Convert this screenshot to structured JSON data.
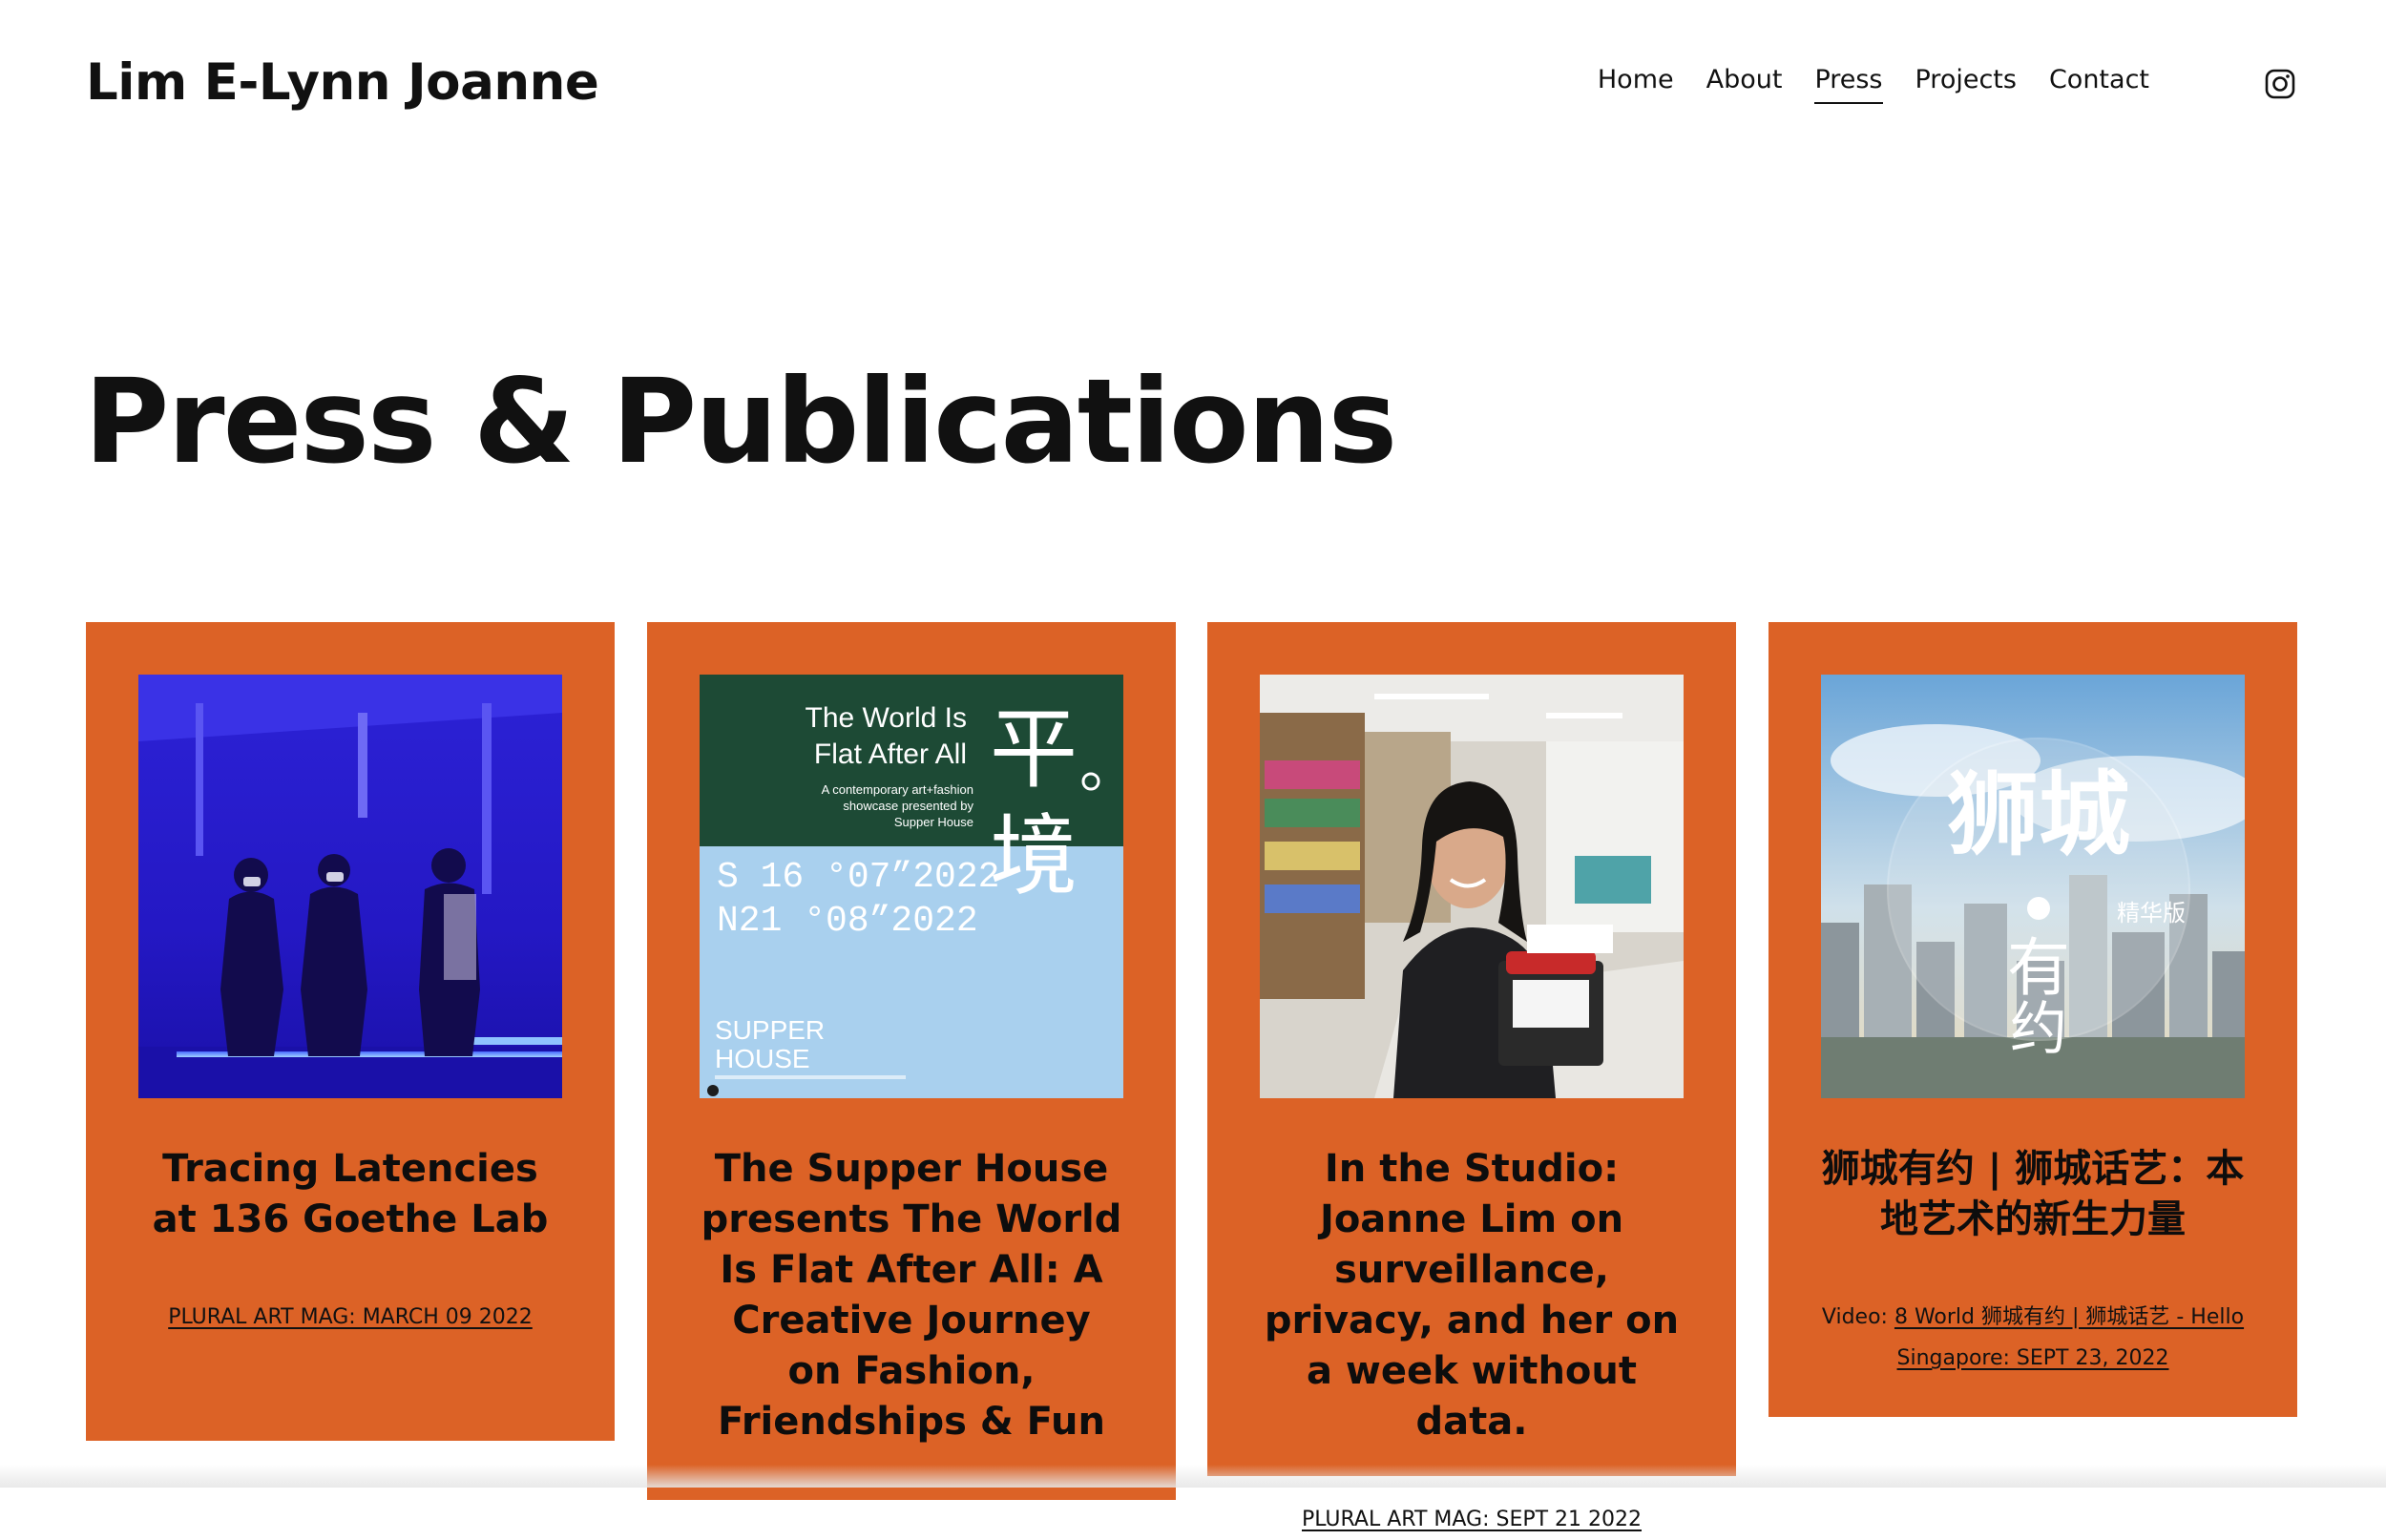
{
  "site": {
    "title": "Lim E-Lynn Joanne"
  },
  "nav": {
    "items": [
      {
        "label": "Home",
        "active": false
      },
      {
        "label": "About",
        "active": false
      },
      {
        "label": "Press",
        "active": true
      },
      {
        "label": "Projects",
        "active": false
      },
      {
        "label": "Contact",
        "active": false
      }
    ],
    "social_icon": "instagram-icon"
  },
  "page": {
    "title": "Press & Publications"
  },
  "cards": [
    {
      "title": "Tracing Latencies at 136 Goethe Lab",
      "meta_prefix": "",
      "meta_link": "PLURAL ART MAG: MARCH 09 2022",
      "image": "three-people-blue-light"
    },
    {
      "title": "The Supper House presents The World Is Flat After All: A Creative Journey on Fashion, Friendships & Fun",
      "meta_prefix": "",
      "meta_link": "",
      "image": "supper-house-poster",
      "poster": {
        "headline_line1": "The World Is",
        "headline_line2": "Flat After All",
        "sub_line1": "A contemporary art+fashion",
        "sub_line2": "showcase presented by",
        "sub_line3": "Supper House",
        "chinese_1": "平",
        "chinese_2": "境",
        "dates_line1": "S 16  °07”2022",
        "dates_line2": "N21  °08”2022",
        "logo_line1": "SUPPER",
        "logo_line2": "HOUSE",
        "colors": {
          "green": "#1d4a35",
          "blue": "#a9d0ee"
        }
      }
    },
    {
      "title": "In the Studio: Joanne Lim on surveillance, privacy, and her on a week without data.",
      "meta_prefix": "",
      "meta_link": "PLURAL ART MAG: SEPT 21 2022",
      "image": "woman-in-studio"
    },
    {
      "title": "狮城有约 | 狮城话艺：本地艺术的新生力量",
      "meta_prefix": "Video: ",
      "meta_link": "8 World 狮城有约 | 狮城话艺 - Hello Singapore: SEPT 23, 2022",
      "image": "singapore-skyline-logo",
      "overlay": {
        "line1": "狮城",
        "line2": "有",
        "line3": "约",
        "badge": "精华版"
      }
    }
  ],
  "colors": {
    "card_bg": "#dc6226",
    "text": "#111111",
    "page_bg": "#ffffff"
  }
}
